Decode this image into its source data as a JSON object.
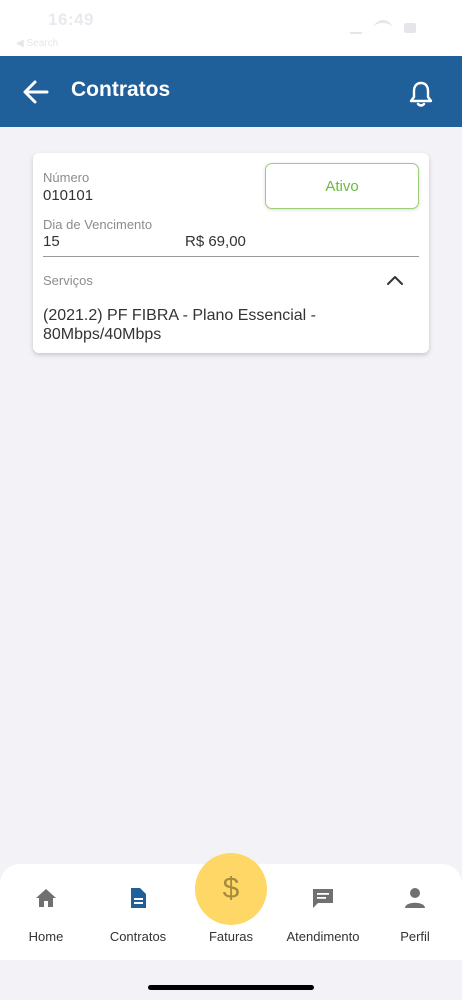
{
  "status_bar": {
    "time": "16:49",
    "back_label": "◀ Search"
  },
  "header": {
    "title": "Contratos",
    "back_icon": "arrow-left-icon",
    "notification_icon": "bell-icon"
  },
  "contract": {
    "number_label": "Número",
    "number": "010101",
    "status": "Ativo",
    "due_day_label": "Dia de Vencimento",
    "due_day": "15",
    "amount": "R$ 69,00",
    "services_label": "Serviços",
    "service": "(2021.2) PF FIBRA - Plano Essencial - 80Mbps/40Mbps"
  },
  "bottom_nav": {
    "items": [
      {
        "label": "Home",
        "icon": "home-icon",
        "active": false
      },
      {
        "label": "Contratos",
        "icon": "document-icon",
        "active": true
      },
      {
        "label": "Faturas",
        "icon": "dollar-icon",
        "active": false
      },
      {
        "label": "Atendimento",
        "icon": "chat-icon",
        "active": false
      },
      {
        "label": "Perfil",
        "icon": "person-icon",
        "active": false
      }
    ],
    "faturas_symbol": "$"
  },
  "colors": {
    "header_bg": "#1f5f9a",
    "status_green": "#6cb93d",
    "faturas_yellow": "#ffd766",
    "active_nav_blue": "#1f5f9a",
    "inactive_nav_gray": "#707070"
  }
}
